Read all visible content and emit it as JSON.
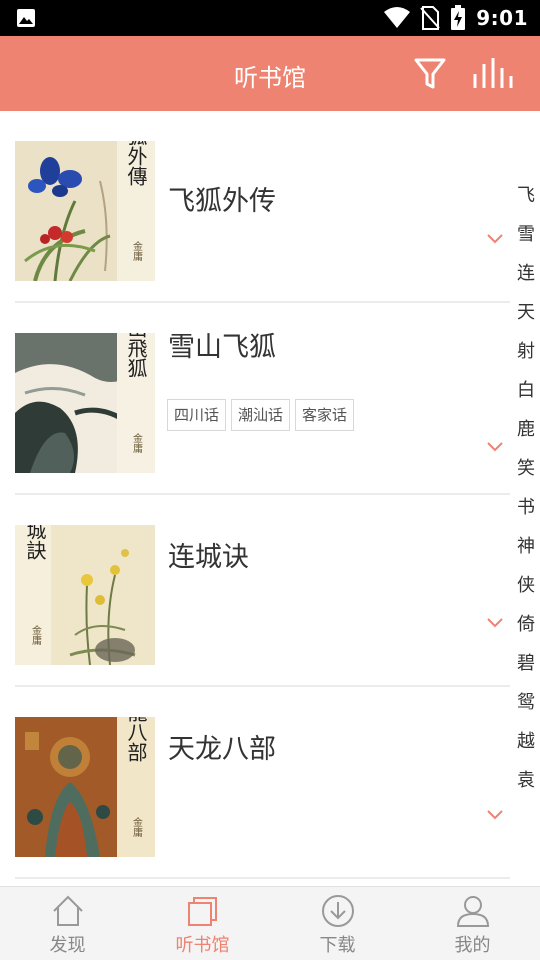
{
  "status_bar": {
    "time": "9:01",
    "icons": [
      "image-notification-icon",
      "wifi-icon",
      "no-sim-icon",
      "battery-charging-icon"
    ]
  },
  "header": {
    "title": "听书馆",
    "filter_icon": "filter-icon",
    "stats_icon": "equalizer-icon",
    "background": "#ef8371"
  },
  "books": [
    {
      "title": "飞狐外传",
      "cover_calligraphy": "飛狐外傳",
      "tags": []
    },
    {
      "title": "雪山飞狐",
      "cover_calligraphy": "雪山飛狐",
      "tags": [
        "四川话",
        "潮汕话",
        "客家话"
      ]
    },
    {
      "title": "连城诀",
      "cover_calligraphy": "連城訣",
      "tags": []
    },
    {
      "title": "天龙八部",
      "cover_calligraphy": "天龍八部",
      "tags": []
    }
  ],
  "cover_signature": "金庸",
  "index_letters": [
    "飞",
    "雪",
    "连",
    "天",
    "射",
    "白",
    "鹿",
    "笑",
    "书",
    "神",
    "侠",
    "倚",
    "碧",
    "鸳",
    "越",
    "袁"
  ],
  "bottom_nav": [
    {
      "label": "发现",
      "icon": "home-icon",
      "active": false
    },
    {
      "label": "听书馆",
      "icon": "library-icon",
      "active": true
    },
    {
      "label": "下载",
      "icon": "download-icon",
      "active": false
    },
    {
      "label": "我的",
      "icon": "profile-icon",
      "active": false
    }
  ],
  "colors": {
    "accent": "#ef8371",
    "tag_border": "#d8d8d8",
    "nav_inactive": "#888888"
  }
}
